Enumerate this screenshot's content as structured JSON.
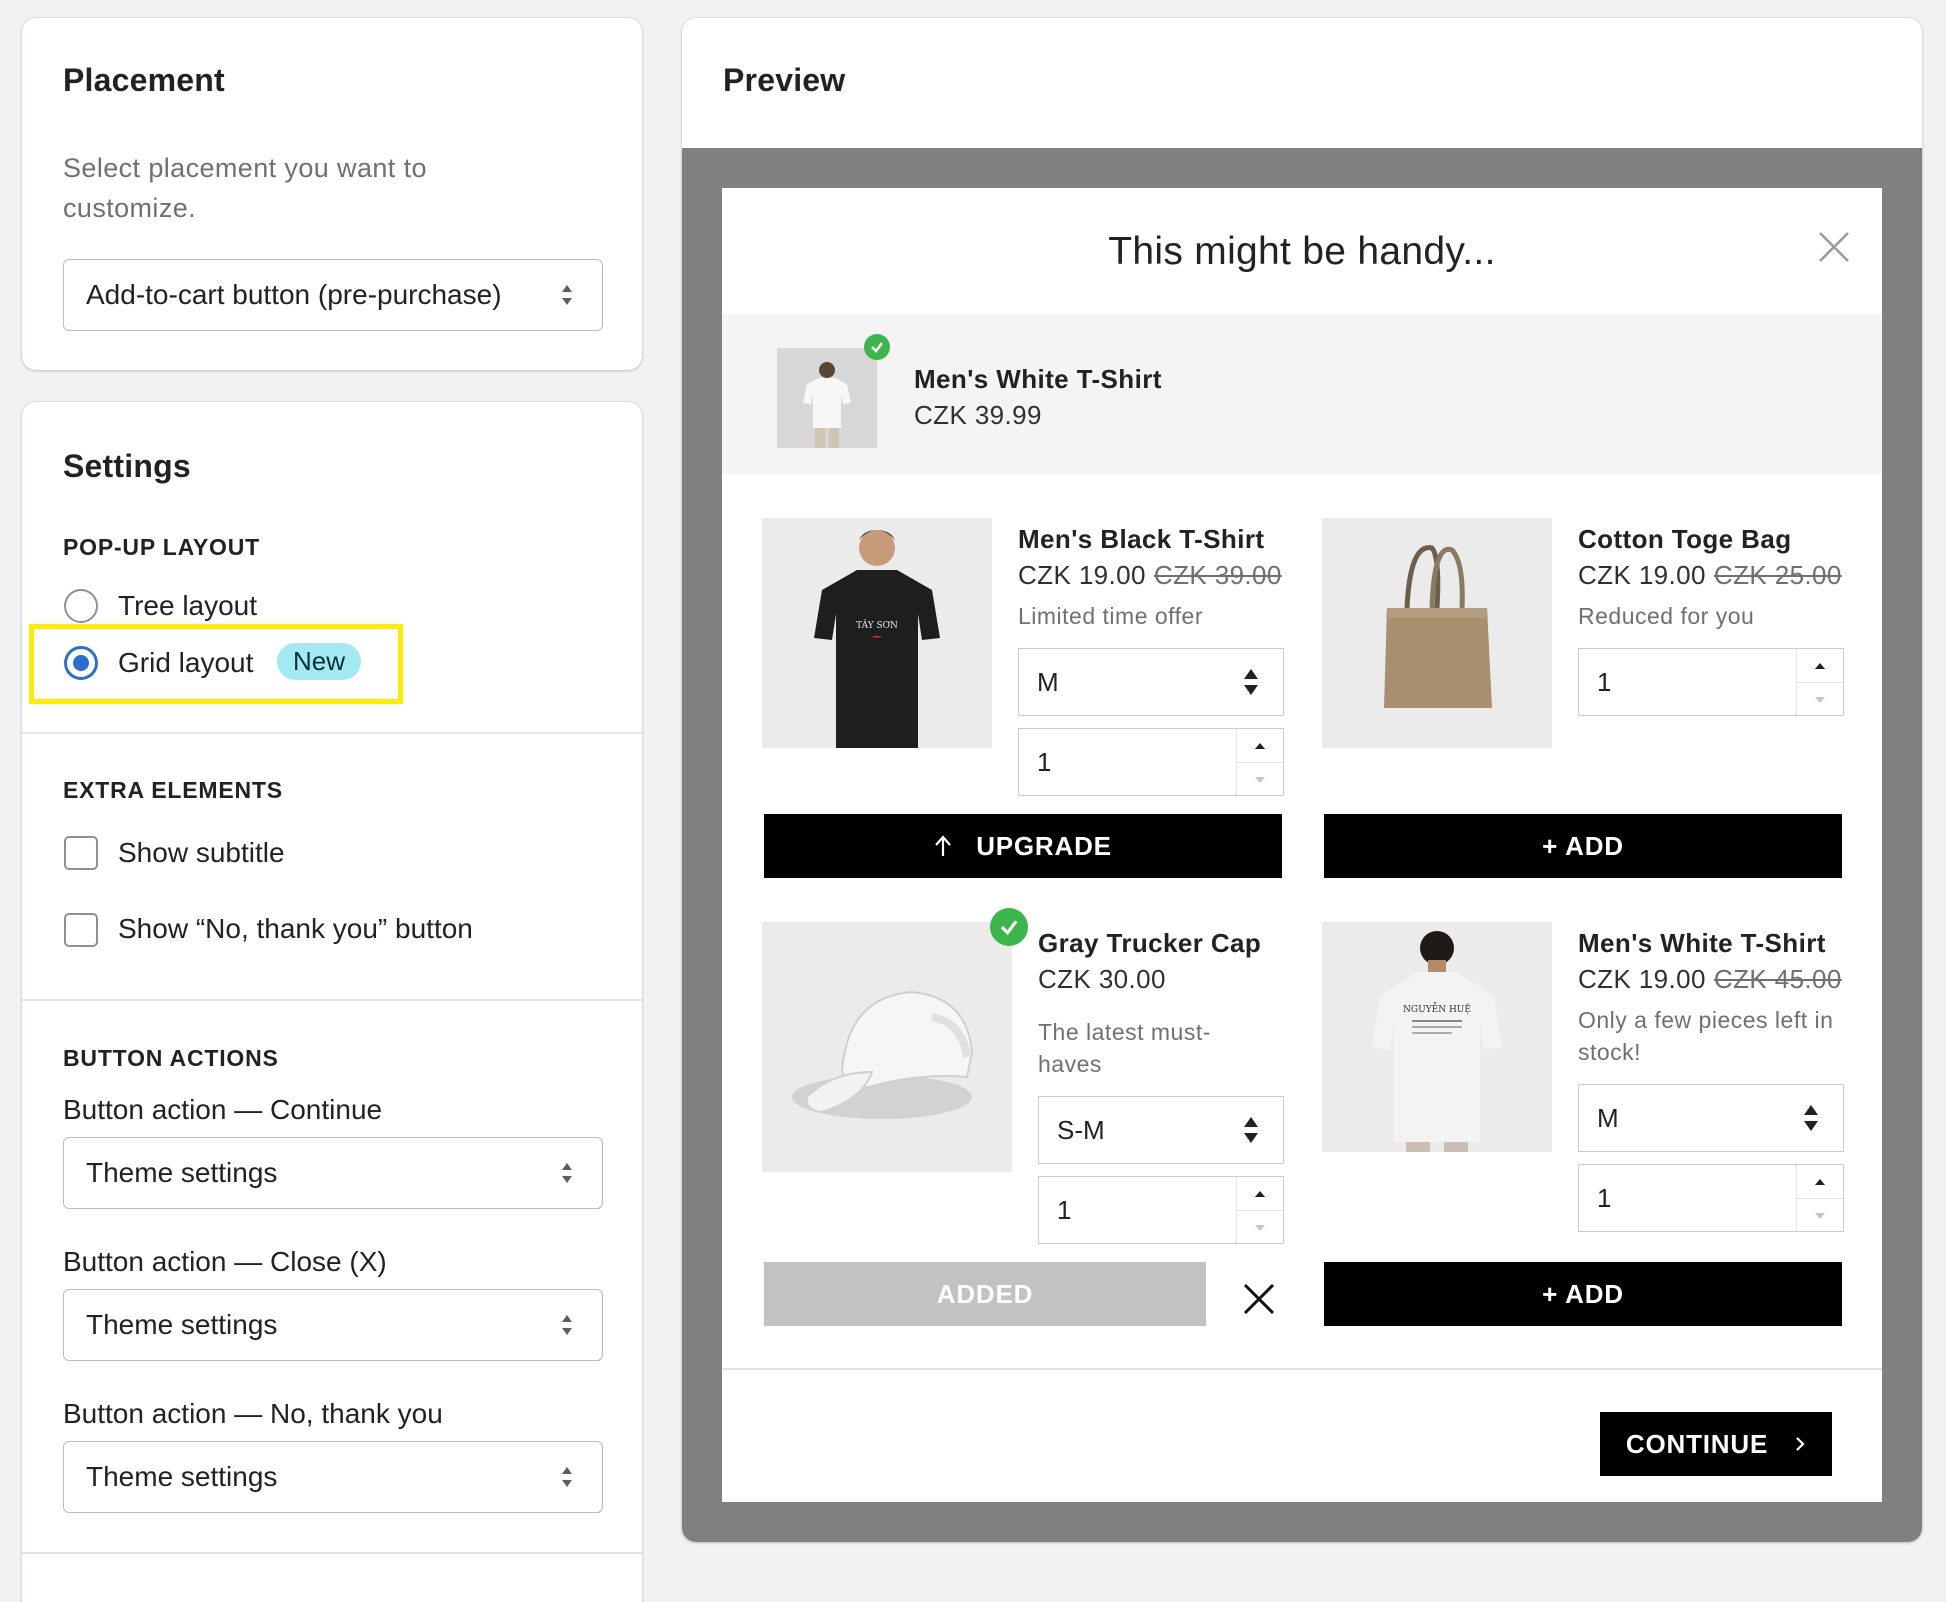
{
  "placement": {
    "title": "Placement",
    "description": "Select placement you want to customize.",
    "select_value": "Add-to-cart button (pre-purchase)"
  },
  "settings": {
    "title": "Settings",
    "popup_layout": {
      "label": "POP-UP LAYOUT",
      "options": [
        {
          "label": "Tree layout",
          "selected": false
        },
        {
          "label": "Grid layout",
          "selected": true,
          "badge": "New"
        }
      ]
    },
    "extra_elements": {
      "label": "EXTRA ELEMENTS",
      "options": [
        {
          "label": "Show subtitle",
          "checked": false
        },
        {
          "label": "Show “No, thank you” button",
          "checked": false
        }
      ]
    },
    "button_actions": {
      "label": "BUTTON ACTIONS",
      "items": [
        {
          "label": "Button action — Continue",
          "value": "Theme settings"
        },
        {
          "label": "Button action — Close (X)",
          "value": "Theme settings"
        },
        {
          "label": "Button action — No, thank you",
          "value": "Theme settings"
        }
      ]
    }
  },
  "preview": {
    "title": "Preview",
    "modal": {
      "heading": "This might be handy...",
      "main_product": {
        "name": "Men's White T-Shirt",
        "price": "CZK 39.99"
      },
      "products": [
        {
          "name": "Men's Black T-Shirt",
          "price": "CZK 19.00",
          "old_price": "CZK 39.00",
          "subtitle": "Limited time offer",
          "variant": "M",
          "quantity": "1",
          "button": "UPGRADE",
          "button_icon": "arrow-up-icon",
          "print_text": "TÂY SƠN"
        },
        {
          "name": "Cotton Toge Bag",
          "price": "CZK 19.00",
          "old_price": "CZK 25.00",
          "subtitle": "Reduced for you",
          "quantity": "1",
          "button": "+ ADD"
        },
        {
          "name": "Gray Trucker Cap",
          "price": "CZK 30.00",
          "subtitle": "The latest must-haves",
          "variant": "S-M",
          "quantity": "1",
          "button": "ADDED",
          "added": true
        },
        {
          "name": "Men's White T-Shirt",
          "price": "CZK 19.00",
          "old_price": "CZK 45.00",
          "subtitle": "Only a few pieces left in stock!",
          "variant": "M",
          "quantity": "1",
          "button": "+ ADD",
          "print_text": "NGUYỄN HUỆ"
        }
      ],
      "continue_label": "CONTINUE"
    }
  },
  "colors": {
    "accent_blue": "#2c6ecb",
    "highlight_yellow": "#ffeb0a",
    "badge_bg": "#a4e8f2",
    "check_green": "#3cb54a",
    "preview_backdrop": "#808080"
  }
}
